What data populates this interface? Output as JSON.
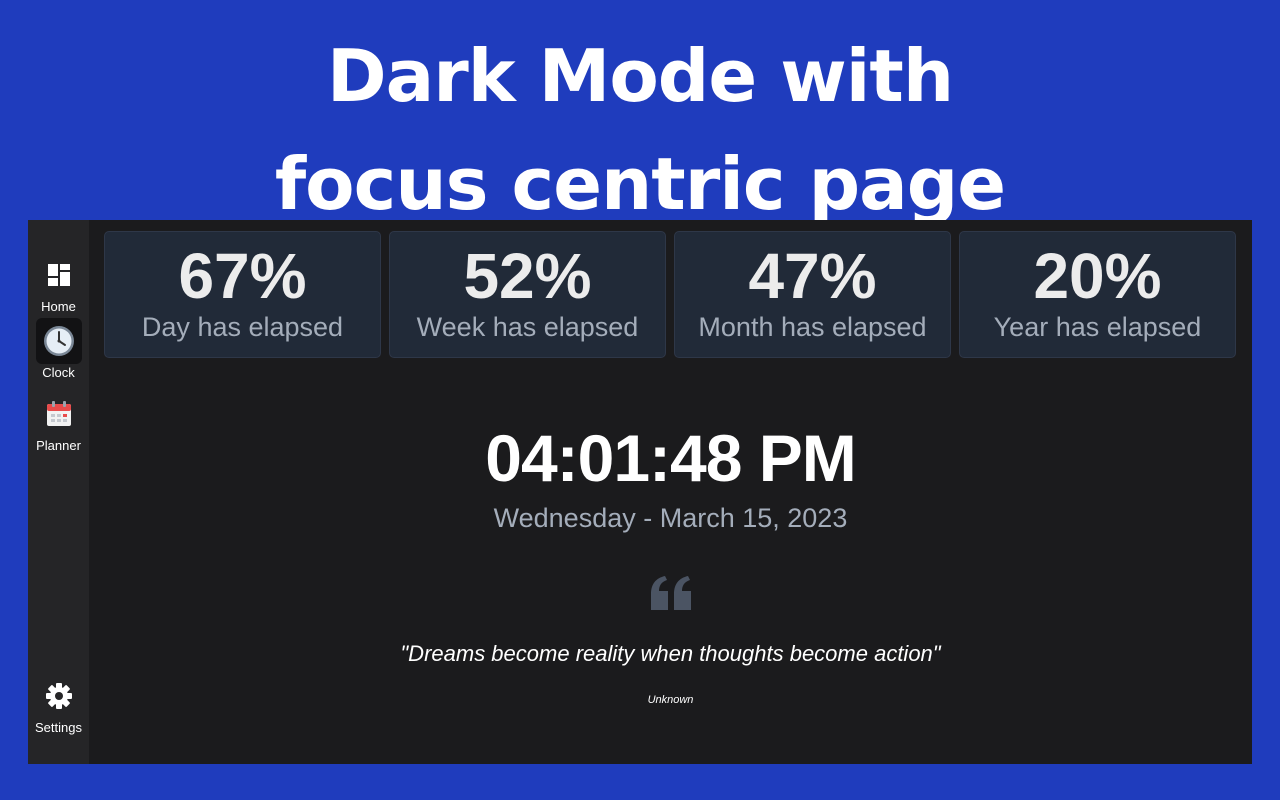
{
  "banner": {
    "line1": "Dark Mode with",
    "line2": "focus centric page"
  },
  "sidebar": {
    "items": [
      {
        "label": "Home",
        "icon": "dashboard-icon",
        "active": false
      },
      {
        "label": "Clock",
        "icon": "clock-icon",
        "active": true
      },
      {
        "label": "Planner",
        "icon": "calendar-icon",
        "active": false
      },
      {
        "label": "Settings",
        "icon": "gear-icon",
        "active": false
      }
    ]
  },
  "stats": [
    {
      "value": "67%",
      "label": "Day has elapsed"
    },
    {
      "value": "52%",
      "label": "Week has elapsed"
    },
    {
      "value": "47%",
      "label": "Month has elapsed"
    },
    {
      "value": "20%",
      "label": "Year has elapsed"
    }
  ],
  "clock": {
    "time": "04:01:48 PM",
    "date": "Wednesday - March 15, 2023"
  },
  "quote": {
    "icon": "quote-icon",
    "text": "\"Dreams become reality when thoughts become action\"",
    "author": "Unknown"
  },
  "colors": {
    "banner_background": "#1f3cbd",
    "app_background": "#1b1b1d",
    "sidebar_background": "#252527",
    "card_background": "#212a38",
    "muted_text": "#a4adba",
    "quote_icon": "#4b5463"
  }
}
